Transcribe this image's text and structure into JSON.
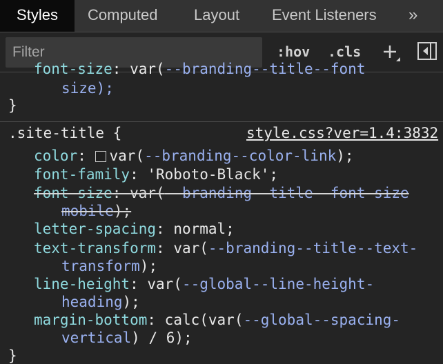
{
  "tabs": {
    "styles": "Styles",
    "computed": "Computed",
    "layout": "Layout",
    "event_listeners": "Event Listeners",
    "more": "»"
  },
  "filter": {
    "placeholder": "Filter",
    "hov": ":hov",
    "cls": ".cls"
  },
  "prev_rule": {
    "line1_prop": "font-size",
    "line1_var": "--branding--title--font",
    "line2": "size);",
    "close": "}"
  },
  "rule": {
    "selector": ".site-title {",
    "source": "style.css?ver=1.4:3832",
    "close": "}",
    "decl": {
      "color_prop": "color",
      "color_var": "--branding--color-link",
      "ff_prop": "font-family",
      "ff_val": "'Roboto-Black'",
      "fs_prop": "font-size",
      "fs_var": "--branding--title--font-size",
      "fs_cont": "mobile",
      "ls_prop": "letter-spacing",
      "ls_val": "normal",
      "tt_prop": "text-transform",
      "tt_var": "--branding--title--text-",
      "tt_cont": "transform",
      "lh_prop": "line-height",
      "lh_var": "--global--line-height-",
      "lh_cont": "heading",
      "mb_prop": "margin-bottom",
      "mb_var": "--global--spacing-",
      "mb_cont": "vertical",
      "mb_tail": ") / 6);"
    }
  },
  "colors": {
    "property": "#8fdadf",
    "variable": "#9ab1f0",
    "active_tab": "#0b0b0b"
  }
}
